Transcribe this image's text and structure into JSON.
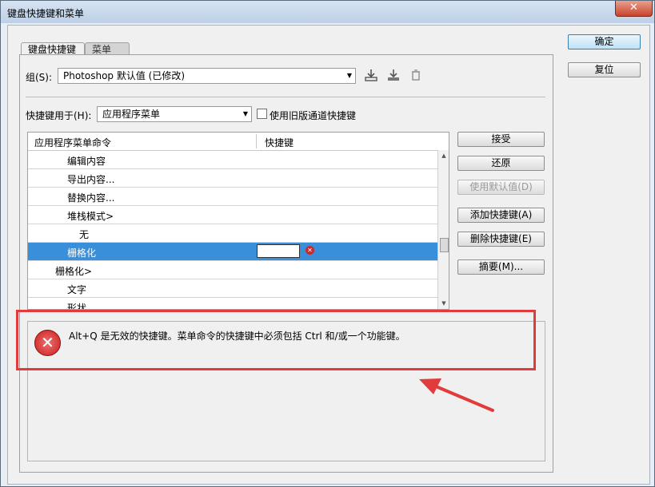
{
  "window": {
    "title": "键盘快捷键和菜单",
    "close_label": "✕"
  },
  "tabs": [
    {
      "label": "键盘快捷键"
    },
    {
      "label": "菜单"
    }
  ],
  "side_buttons": {
    "ok": "确定",
    "reset": "复位"
  },
  "set_row": {
    "label": "组(S):",
    "value": "Photoshop 默认值 (已修改)"
  },
  "shortcuts_for": {
    "label": "快捷键用于(H):",
    "value": "应用程序菜单",
    "legacy_checkbox_label": "使用旧版通道快捷键",
    "legacy_checked": false
  },
  "table": {
    "columns": [
      "应用程序菜单命令",
      "快捷键"
    ],
    "rows": [
      {
        "command": "编辑内容",
        "shortcut": ""
      },
      {
        "command": "导出内容...",
        "shortcut": ""
      },
      {
        "command": "替换内容...",
        "shortcut": ""
      },
      {
        "command": "堆栈模式>",
        "shortcut": ""
      },
      {
        "command": "无",
        "shortcut": ""
      },
      {
        "command": "栅格化",
        "shortcut": ""
      },
      {
        "command": "栅格化>",
        "shortcut": ""
      },
      {
        "command": "文字",
        "shortcut": ""
      },
      {
        "command": "形状",
        "shortcut": ""
      }
    ]
  },
  "right_buttons": {
    "accept": "接受",
    "undo": "还原",
    "use_default": "使用默认值(D)",
    "add_shortcut": "添加快捷键(A)",
    "delete_shortcut": "删除快捷键(E)",
    "summarize": "摘要(M)..."
  },
  "message": {
    "text": "Alt+Q 是无效的快捷键。菜单命令的快捷键中必须包括 Ctrl 和/或一个功能键。"
  },
  "colors": {
    "selection": "#3a8fdb",
    "annotation": "#e23b3b",
    "error": "#c81e1e"
  }
}
